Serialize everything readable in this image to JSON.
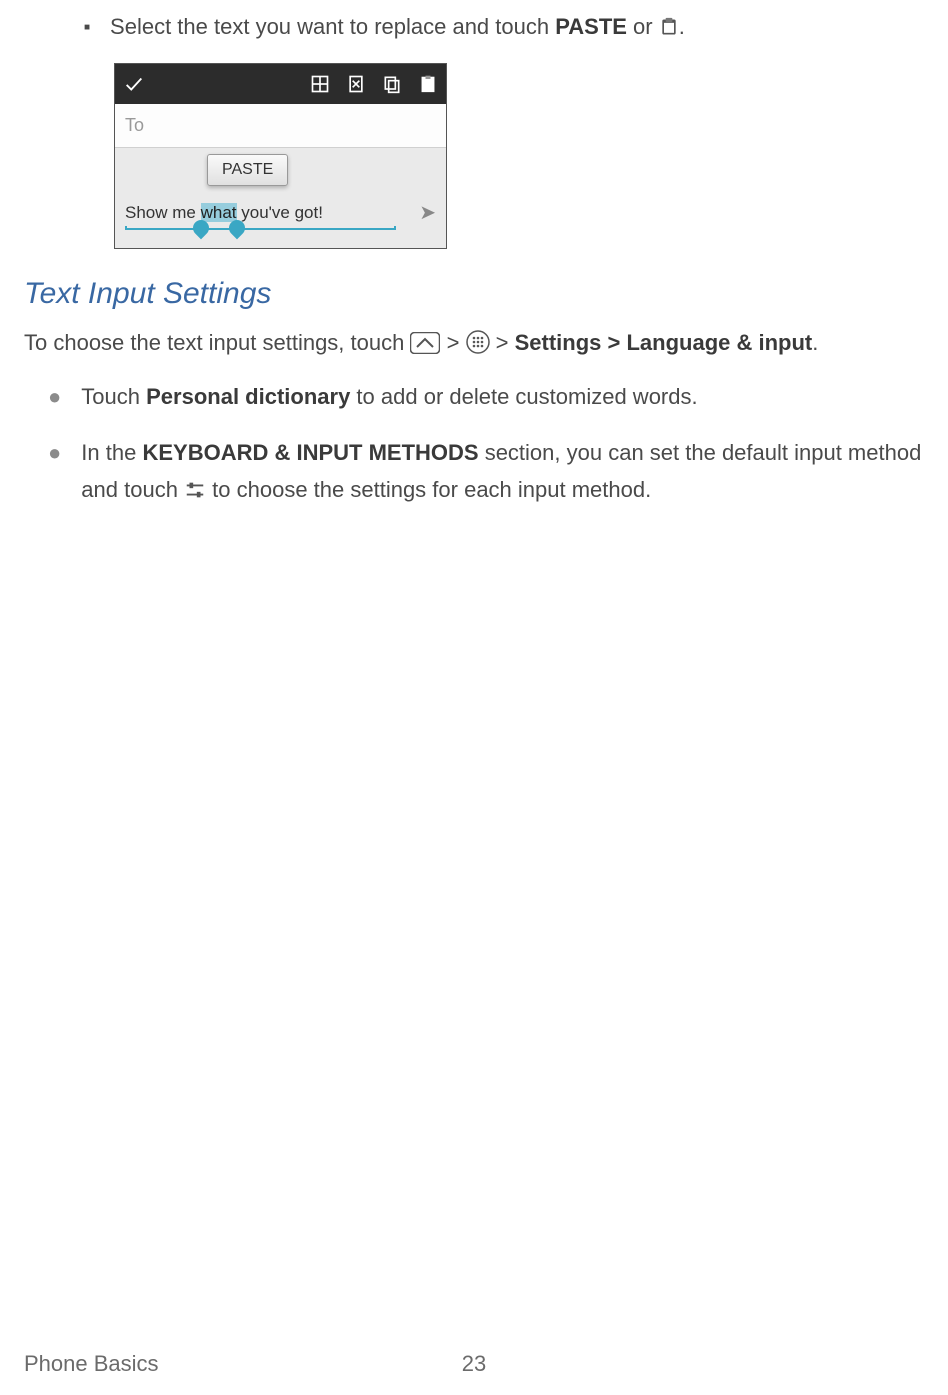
{
  "step": {
    "prefix": "Select the text you want to replace and touch ",
    "bold": "PASTE",
    "mid": " or ",
    "suffix": "."
  },
  "screenshot": {
    "to_label": "To",
    "paste_button": "PASTE",
    "text_before": "Show me ",
    "text_selected": "what",
    "text_after": " you've got!"
  },
  "heading": "Text Input Settings",
  "intro": {
    "prefix": "To choose the text input settings, touch ",
    "gt1": " > ",
    "gt2": " > ",
    "bold_tail": "Settings > Language & input",
    "suffix": "."
  },
  "bullets": {
    "b1": {
      "prefix": "Touch ",
      "bold": "Personal dictionary",
      "suffix": " to add or delete customized words."
    },
    "b2": {
      "prefix": "In the ",
      "bold": "KEYBOARD & INPUT METHODS",
      "mid": " section, you can set the default input method and touch ",
      "suffix": " to choose the settings for each input method."
    }
  },
  "footer": {
    "section": "Phone Basics",
    "page": "23"
  }
}
